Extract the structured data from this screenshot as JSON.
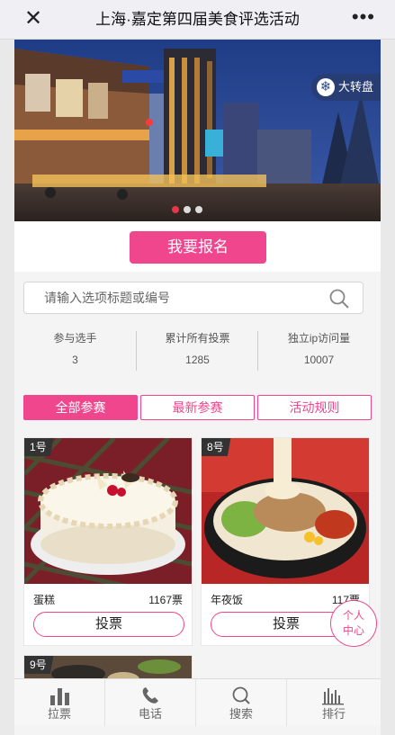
{
  "topbar": {
    "title": "上海·嘉定第四届美食评选活动",
    "close_icon": "close-icon",
    "more_icon": "more-icon"
  },
  "banner": {
    "wheel_label": "大转盘",
    "wheel_icon": "snowflake-icon",
    "slide_count": 3,
    "active_slide": 1
  },
  "signup": {
    "label": "我要报名"
  },
  "search": {
    "placeholder": "请输入选项标题或编号",
    "icon": "search-icon"
  },
  "stats": [
    {
      "label": "参与选手",
      "value": "3"
    },
    {
      "label": "累计所有投票",
      "value": "1285"
    },
    {
      "label": "独立ip访问量",
      "value": "10007"
    }
  ],
  "tabs": [
    {
      "label": "全部参赛",
      "active": true
    },
    {
      "label": "最新参赛",
      "active": false
    },
    {
      "label": "活动规则",
      "active": false
    }
  ],
  "entries": [
    {
      "num": "1号",
      "name": "蛋糕",
      "votes": "1167票",
      "vote_label": "投票"
    },
    {
      "num": "8号",
      "name": "年夜饭",
      "votes": "117票",
      "vote_label": "投票"
    },
    {
      "num": "9号"
    }
  ],
  "float_button": {
    "line1": "个人",
    "line2": "中心"
  },
  "nav": [
    {
      "label": "拉票",
      "icon": "bar-chart-icon"
    },
    {
      "label": "电话",
      "icon": "phone-icon"
    },
    {
      "label": "搜索",
      "icon": "search-icon"
    },
    {
      "label": "排行",
      "icon": "ranking-icon"
    }
  ],
  "colors": {
    "accent": "#f0468e",
    "dot_active": "#e4384a"
  }
}
